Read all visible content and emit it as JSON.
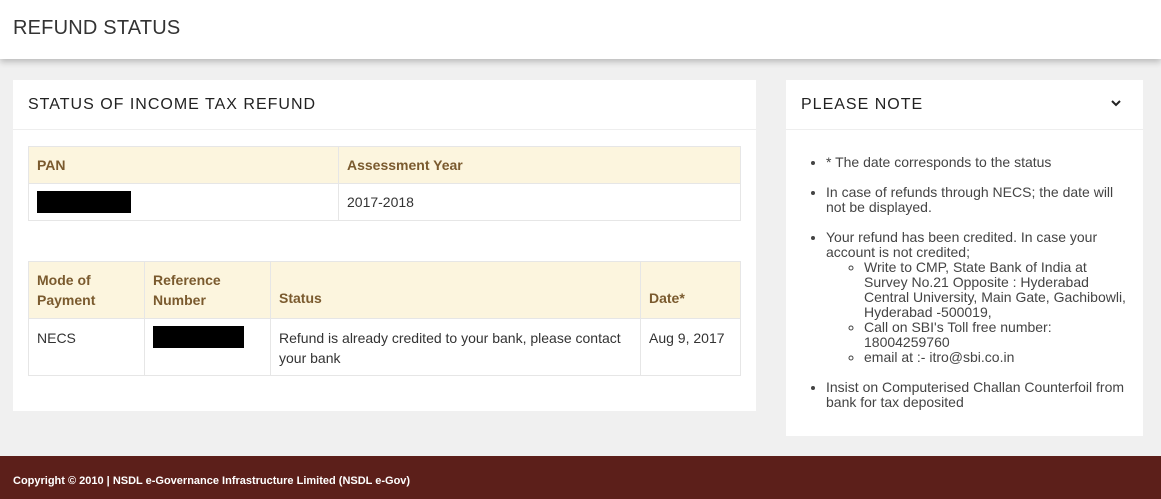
{
  "header": {
    "title": "REFUND STATUS"
  },
  "refund_card": {
    "title": "STATUS OF INCOME TAX REFUND",
    "pan_table": {
      "columns": [
        "PAN",
        "Assessment Year"
      ],
      "row": {
        "pan": "",
        "assessment_year": "2017-2018"
      }
    },
    "status_table": {
      "columns": [
        "Mode of Payment",
        "Reference Number",
        "Status",
        "Date*"
      ],
      "row": {
        "mode": "NECS",
        "reference": "",
        "status": "Refund is already credited to your bank, please contact your bank",
        "date": "Aug 9, 2017"
      }
    }
  },
  "note_card": {
    "title": "PLEASE NOTE",
    "icon": "chevron-down-icon",
    "items": [
      "* The date corresponds to the status",
      "In case of refunds through NECS; the date will not be displayed.",
      "Your refund has been credited. In case your account is not credited;",
      "Insist on Computerised Challan Counterfoil from bank for tax deposited"
    ],
    "subitems": [
      "Write to CMP, State Bank of India at Survey No.21 Opposite : Hyderabad Central University, Main Gate, Gachibowli, Hyderabad -500019,",
      "Call on SBI's Toll free number: 18004259760",
      "email at :- itro@sbi.co.in"
    ]
  },
  "footer": {
    "text": "Copyright © 2010 | NSDL e-Governance Infrastructure Limited (NSDL e-Gov)"
  },
  "colors": {
    "header_bg": "#ffffff",
    "table_header_bg": "#fcf5de",
    "table_header_text": "#7a5a2e",
    "footer_bg": "#5c1f1a"
  }
}
